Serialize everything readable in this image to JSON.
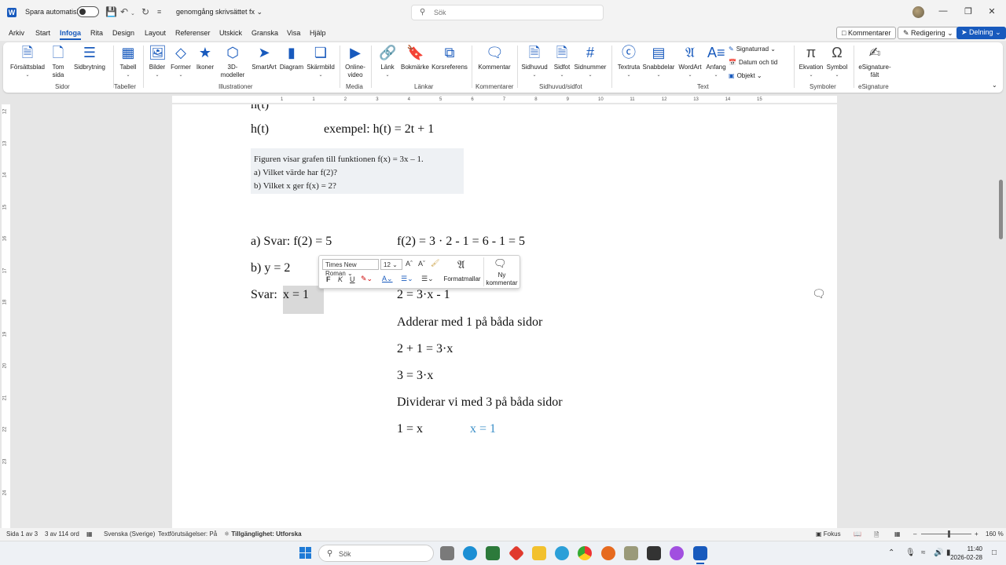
{
  "titlebar": {
    "autosave_label": "Spara automatiskt",
    "doc_title": "genomgång skrivsättet fx ⌄",
    "search_placeholder": "Sök"
  },
  "menu": {
    "tabs": [
      "Arkiv",
      "Start",
      "Infoga",
      "Rita",
      "Design",
      "Layout",
      "Referenser",
      "Utskick",
      "Granska",
      "Visa",
      "Hjälp"
    ],
    "active_tab": "Infoga",
    "comments_label": "Kommentarer",
    "editing_label": "Redigering",
    "share_label": "Delning"
  },
  "ribbon": {
    "buttons": [
      {
        "label": "Försättsblad",
        "icon": "cover-page-icon"
      },
      {
        "label": "Tom\nsida",
        "icon": "blank-page-icon"
      },
      {
        "label": "Sidbrytning",
        "icon": "page-break-icon"
      },
      {
        "label": "Tabell",
        "icon": "table-icon"
      },
      {
        "label": "Bilder",
        "icon": "pictures-icon"
      },
      {
        "label": "Former",
        "icon": "shapes-icon"
      },
      {
        "label": "Ikoner",
        "icon": "icons-icon"
      },
      {
        "label": "3D-\nmodeller",
        "icon": "3d-models-icon"
      },
      {
        "label": "SmartArt",
        "icon": "smartart-icon"
      },
      {
        "label": "Diagram",
        "icon": "chart-icon"
      },
      {
        "label": "Skärmbild",
        "icon": "screenshot-icon"
      },
      {
        "label": "Online-\nvideo",
        "icon": "online-video-icon"
      },
      {
        "label": "Länk",
        "icon": "link-icon"
      },
      {
        "label": "Bokmärke",
        "icon": "bookmark-icon"
      },
      {
        "label": "Korsreferens",
        "icon": "cross-reference-icon"
      },
      {
        "label": "Kommentar",
        "icon": "comment-icon"
      },
      {
        "label": "Sidhuvud",
        "icon": "header-icon"
      },
      {
        "label": "Sidfot",
        "icon": "footer-icon"
      },
      {
        "label": "Sidnummer",
        "icon": "page-number-icon"
      },
      {
        "label": "Textruta",
        "icon": "text-box-icon"
      },
      {
        "label": "Snabbdelar",
        "icon": "quick-parts-icon"
      },
      {
        "label": "WordArt",
        "icon": "wordart-icon"
      },
      {
        "label": "Anfang",
        "icon": "drop-cap-icon"
      },
      {
        "label": "Ekvation",
        "icon": "equation-icon"
      },
      {
        "label": "Symbol",
        "icon": "symbol-icon"
      },
      {
        "label": "eSignature-\nfält",
        "icon": "esignature-icon"
      }
    ],
    "small_buttons": [
      "Signaturrad",
      "Datum och tid",
      "Objekt"
    ],
    "groups": [
      "Sidor",
      "Tabeller",
      "Illustrationer",
      "Media",
      "Länkar",
      "Kommentarer",
      "Sidhuvud/sidfot",
      "Text",
      "Symboler",
      "eSignature"
    ]
  },
  "document": {
    "cut_line": "h(t)",
    "line1_left": "h(t)",
    "line1_right": "exempel: h(t) = 2t + 1",
    "image_lines": [
      "Figuren visar grafen till funktionen f(x) = 3x – 1.",
      "a)  Vilket värde har f(2)?",
      "b)  Vilket x ger f(x) = 2?"
    ],
    "a_answer": "a) Svar: f(2) = 5",
    "a_work": "f(2) = 3 · 2 - 1 = 6 - 1 = 5",
    "b_line": "b) y = 2",
    "svar_label": "Svar:",
    "svar_value": "x = 1",
    "steps": [
      "2 = 3·x - 1",
      "Adderar med 1 på båda sidor",
      "2 + 1 = 3·x",
      "3 = 3·x",
      "Dividerar vi med 3 på båda sidor"
    ],
    "last_left": "1 = x",
    "last_right": "x = 1"
  },
  "minitoolbar": {
    "font": "Times New Roman",
    "size": "12",
    "styles_label": "Formatmallar",
    "new_comment_label": "Ny\nkommentar",
    "bold": "F",
    "italic": "K",
    "underline": "U"
  },
  "statusbar": {
    "page": "Sida 1 av 3",
    "words": "3 av 114 ord",
    "language": "Svenska (Sverige)",
    "predictions": "Textförutsägelser: På",
    "accessibility": "Tillgänglighet: Utforska",
    "focus": "Fokus",
    "zoom": "160 %"
  },
  "taskbar": {
    "search_placeholder": "Sök",
    "time": "11:40",
    "date": "2026-02-28"
  },
  "colors": {
    "accent": "#185abd",
    "answer_blue": "#3b8fc7",
    "selection": "#d9d9d9"
  }
}
